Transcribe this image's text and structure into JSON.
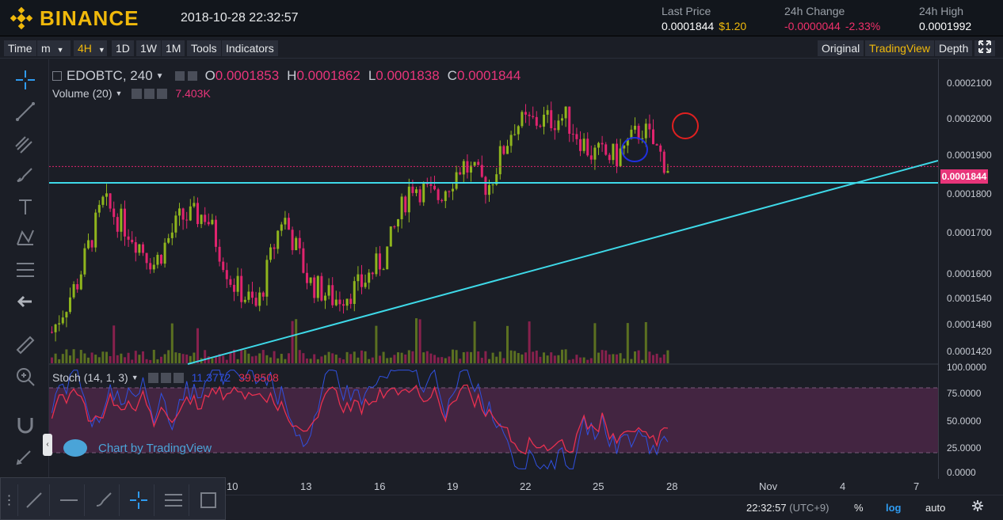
{
  "header": {
    "brand": "BINANCE",
    "datetime": "2018-10-28 22:32:57",
    "stats": [
      {
        "label": "Last Price",
        "value": "0.0001844",
        "extra": "$1.20"
      },
      {
        "label": "24h Change",
        "value": "-0.0000044",
        "extra": "-2.33%"
      },
      {
        "label": "24h High",
        "value": "0.0001992",
        "extra": ""
      }
    ]
  },
  "toolbar": {
    "time": "Time",
    "minutes": "m",
    "four_hour": "4H",
    "one_day": "1D",
    "one_week": "1W",
    "one_month": "1M",
    "tools": "Tools",
    "indicators": "Indicators",
    "original": "Original",
    "tradingview": "TradingView",
    "depth": "Depth"
  },
  "legend": {
    "symbol": "EDOBTC, 240",
    "o_label": "O",
    "o_value": "0.0001853",
    "h_label": "H",
    "h_value": "0.0001862",
    "l_label": "L",
    "l_value": "0.0001838",
    "c_label": "C",
    "c_value": "0.0001844",
    "volume_label": "Volume (20)",
    "volume_value": "7.403K",
    "stoch_label": "Stoch (14, 1, 3)",
    "stoch_k": "11.3772",
    "stoch_d": "39.8508"
  },
  "price_axis": {
    "ticks": [
      "0.0002100",
      "0.0002000",
      "0.0001900",
      "0.0001800",
      "0.0001700",
      "0.0001600",
      "0.0001540",
      "0.0001480",
      "0.0001420"
    ],
    "current_price": "0.0001844",
    "stoch_ticks": [
      "100.0000",
      "75.0000",
      "50.0000",
      "25.0000",
      "0.0000"
    ]
  },
  "time_axis": {
    "labels": [
      "10",
      "13",
      "16",
      "19",
      "22",
      "25",
      "28",
      "Nov",
      "4",
      "7"
    ]
  },
  "status_bar": {
    "clock": "22:32:57",
    "tz": "(UTC+9)",
    "percent": "%",
    "log": "log",
    "auto": "auto"
  },
  "watermark": "Chart by TradingView",
  "colors": {
    "up": "#8fb51d",
    "down": "#e0246e",
    "trendline": "#3ed9e8",
    "accent": "#f0b90b",
    "stoch_k": "#3050e0",
    "stoch_d": "#e83050"
  },
  "chart_data": {
    "type": "line",
    "series": [
      {
        "name": "C",
        "values": [
          0.000145,
          0.000156,
          0.000175,
          0.000168,
          0.00016,
          0.000171,
          0.000172,
          0.000156,
          0.00015,
          0.000172,
          0.000156,
          0.000152,
          0.000155,
          0.000162,
          0.00018,
          0.000176,
          0.000185,
          0.000179,
          0.000196,
          0.000197,
          0.000198,
          0.000188,
          0.000187,
          0.000195,
          0.0001844
        ]
      }
    ],
    "ylim": [
      0.00014,
      0.000213
    ],
    "log_scale": true
  }
}
